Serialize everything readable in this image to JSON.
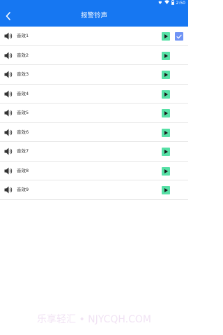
{
  "status_bar": {
    "background": "#1677f2",
    "icons": [
      "heart-icon",
      "wifi-icon",
      "battery-icon"
    ],
    "time": "2:50"
  },
  "header": {
    "title": "报警铃声",
    "back_icon": "chevron-left-icon",
    "background": "#1677f2"
  },
  "sounds": [
    {
      "label": "音效1",
      "selected": true
    },
    {
      "label": "音效2",
      "selected": false
    },
    {
      "label": "音效3",
      "selected": false
    },
    {
      "label": "音效4",
      "selected": false
    },
    {
      "label": "音效5",
      "selected": false
    },
    {
      "label": "音效6",
      "selected": false
    },
    {
      "label": "音效7",
      "selected": false
    },
    {
      "label": "音效8",
      "selected": false
    },
    {
      "label": "音效9",
      "selected": false
    }
  ],
  "colors": {
    "accent": "#1677f2",
    "play_button": "#57e0a6",
    "checkbox": "#6f93f5"
  },
  "watermark": "乐享轻汇 • NJYCQH.COM"
}
